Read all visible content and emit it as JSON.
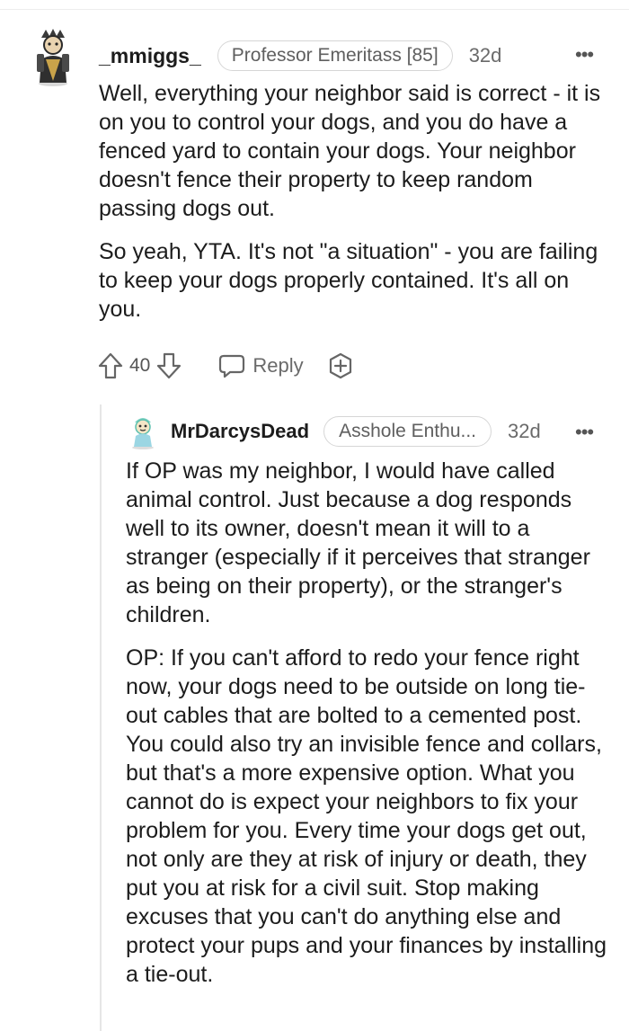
{
  "comment": {
    "username": "_mmiggs_",
    "flair": "Professor Emeritass [85]",
    "age": "32d",
    "paragraphs": [
      "Well, everything your neighbor said is correct - it is on you to control your dogs, and you do have a fenced yard to contain your dogs. Your neighbor doesn't fence their property to keep random passing dogs out.",
      "So yeah, YTA. It's not \"a situation\" - you are failing to keep your dogs properly contained. It's all on you."
    ],
    "score": "40",
    "reply_label": "Reply"
  },
  "reply": {
    "username": "MrDarcysDead",
    "flair": "Asshole Enthu...",
    "age": "32d",
    "paragraphs": [
      "If OP was my neighbor, I would have called animal control. Just because a dog responds well to its owner, doesn't mean it will to a stranger (especially if it perceives that stranger as being on their property), or the stranger's children.",
      "OP: If you can't afford to redo your fence right now, your dogs need to be outside on long tie-out cables that are bolted to a cemented post. You could also try an invisible fence and collars, but that's a more expensive option. What you cannot do is expect your neighbors to fix your problem for you. Every time your dogs get out, not only are they at risk of injury or death, they put you at risk for a civil suit. Stop making excuses that you can't do anything else and protect your pups and your finances by installing a tie-out."
    ]
  },
  "icons": {
    "more": "more-options-icon",
    "upvote": "upvote-arrow-icon",
    "downvote": "downvote-arrow-icon",
    "reply": "speech-bubble-icon",
    "award": "award-plus-icon"
  },
  "colors": {
    "text": "#1c1c1c",
    "meta": "#6a6a6a",
    "border": "#d6d6d6",
    "thread_line": "#e6e6e6"
  }
}
